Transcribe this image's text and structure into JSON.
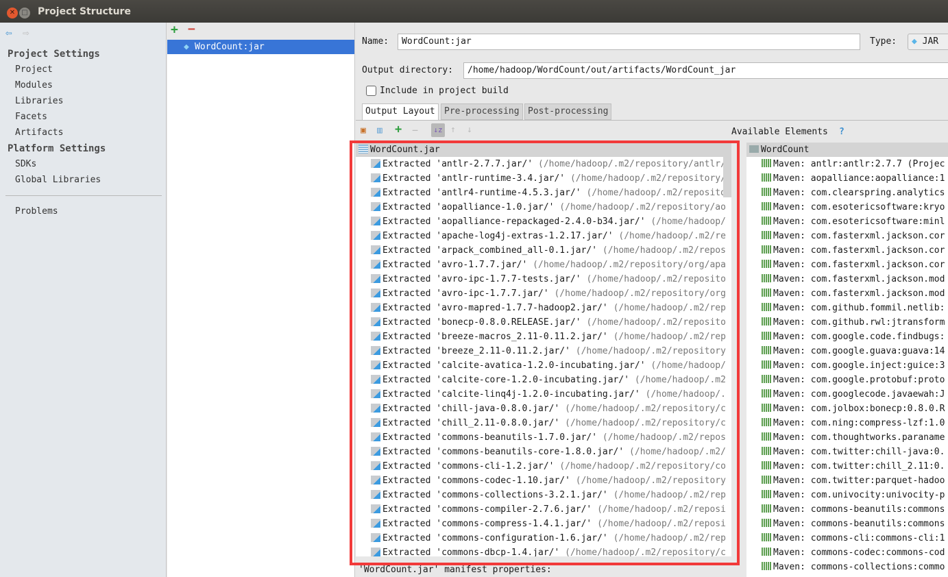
{
  "window": {
    "title": "Project Structure"
  },
  "sidebar": {
    "project_settings": "Project Settings",
    "project_items": [
      "Project",
      "Modules",
      "Libraries",
      "Facets",
      "Artifacts"
    ],
    "platform_settings": "Platform Settings",
    "platform_items": [
      "SDKs",
      "Global Libraries"
    ],
    "problems": "Problems"
  },
  "artifacts": {
    "selected": "WordCount:jar"
  },
  "form": {
    "name_label": "Name:",
    "name_value": "WordCount:jar",
    "type_label": "Type:",
    "type_value": "JAR",
    "output_label": "Output directory:",
    "output_value": "/home/hadoop/WordCount/out/artifacts/WordCount_jar",
    "include_label": "Include in project build",
    "include_checked": false
  },
  "tabs": [
    "Output Layout",
    "Pre-processing",
    "Post-processing"
  ],
  "available_label": "Available Elements",
  "help": "?",
  "tree": {
    "root": "WordCount.jar",
    "prefix": "Extracted",
    "items": [
      {
        "name": "'antlr-2.7.7.jar/'",
        "path": "(/home/hadoop/.m2/repository/antlr/"
      },
      {
        "name": "'antlr-runtime-3.4.jar/'",
        "path": "(/home/hadoop/.m2/repository/"
      },
      {
        "name": "'antlr4-runtime-4.5.3.jar/'",
        "path": "(/home/hadoop/.m2/reposito"
      },
      {
        "name": "'aopalliance-1.0.jar/'",
        "path": "(/home/hadoop/.m2/repository/ao"
      },
      {
        "name": "'aopalliance-repackaged-2.4.0-b34.jar/'",
        "path": "(/home/hadoop/"
      },
      {
        "name": "'apache-log4j-extras-1.2.17.jar/'",
        "path": "(/home/hadoop/.m2/re"
      },
      {
        "name": "'arpack_combined_all-0.1.jar/'",
        "path": "(/home/hadoop/.m2/repos"
      },
      {
        "name": "'avro-1.7.7.jar/'",
        "path": "(/home/hadoop/.m2/repository/org/apa"
      },
      {
        "name": "'avro-ipc-1.7.7-tests.jar/'",
        "path": "(/home/hadoop/.m2/reposito"
      },
      {
        "name": "'avro-ipc-1.7.7.jar/'",
        "path": "(/home/hadoop/.m2/repository/org"
      },
      {
        "name": "'avro-mapred-1.7.7-hadoop2.jar/'",
        "path": "(/home/hadoop/.m2/rep"
      },
      {
        "name": "'bonecp-0.8.0.RELEASE.jar/'",
        "path": "(/home/hadoop/.m2/reposito"
      },
      {
        "name": "'breeze-macros_2.11-0.11.2.jar/'",
        "path": "(/home/hadoop/.m2/rep"
      },
      {
        "name": "'breeze_2.11-0.11.2.jar/'",
        "path": "(/home/hadoop/.m2/repository"
      },
      {
        "name": "'calcite-avatica-1.2.0-incubating.jar/'",
        "path": "(/home/hadoop/"
      },
      {
        "name": "'calcite-core-1.2.0-incubating.jar/'",
        "path": "(/home/hadoop/.m2"
      },
      {
        "name": "'calcite-linq4j-1.2.0-incubating.jar/'",
        "path": "(/home/hadoop/."
      },
      {
        "name": "'chill-java-0.8.0.jar/'",
        "path": "(/home/hadoop/.m2/repository/c"
      },
      {
        "name": "'chill_2.11-0.8.0.jar/'",
        "path": "(/home/hadoop/.m2/repository/c"
      },
      {
        "name": "'commons-beanutils-1.7.0.jar/'",
        "path": "(/home/hadoop/.m2/repos"
      },
      {
        "name": "'commons-beanutils-core-1.8.0.jar/'",
        "path": "(/home/hadoop/.m2/"
      },
      {
        "name": "'commons-cli-1.2.jar/'",
        "path": "(/home/hadoop/.m2/repository/co"
      },
      {
        "name": "'commons-codec-1.10.jar/'",
        "path": "(/home/hadoop/.m2/repository"
      },
      {
        "name": "'commons-collections-3.2.1.jar/'",
        "path": "(/home/hadoop/.m2/rep"
      },
      {
        "name": "'commons-compiler-2.7.6.jar/'",
        "path": "(/home/hadoop/.m2/reposi"
      },
      {
        "name": "'commons-compress-1.4.1.jar/'",
        "path": "(/home/hadoop/.m2/reposi"
      },
      {
        "name": "'commons-configuration-1.6.jar/'",
        "path": "(/home/hadoop/.m2/rep"
      },
      {
        "name": "'commons-dbcp-1.4.jar/'",
        "path": "(/home/hadoop/.m2/repository/c"
      }
    ]
  },
  "manifest_label": "'WordCount.jar' manifest properties:",
  "available": {
    "root": "WordCount",
    "prefix": "Maven:",
    "items": [
      "antlr:antlr:2.7.7 (Projec",
      "aopalliance:aopalliance:1",
      "com.clearspring.analytics",
      "com.esotericsoftware:kryo",
      "com.esotericsoftware:minl",
      "com.fasterxml.jackson.cor",
      "com.fasterxml.jackson.cor",
      "com.fasterxml.jackson.cor",
      "com.fasterxml.jackson.mod",
      "com.fasterxml.jackson.mod",
      "com.github.fommil.netlib:",
      "com.github.rwl:jtransform",
      "com.google.code.findbugs:",
      "com.google.guava:guava:14",
      "com.google.inject:guice:3",
      "com.google.protobuf:proto",
      "com.googlecode.javaewah:J",
      "com.jolbox:bonecp:0.8.0.R",
      "com.ning:compress-lzf:1.0",
      "com.thoughtworks.paraname",
      "com.twitter:chill-java:0.",
      "com.twitter:chill_2.11:0.",
      "com.twitter:parquet-hadoo",
      "com.univocity:univocity-p",
      "commons-beanutils:commons",
      "commons-beanutils:commons",
      "commons-cli:commons-cli:1",
      "commons-codec:commons-cod",
      "commons-collections:commo"
    ]
  },
  "colors": {
    "selection": "#3875d7",
    "highlight_box": "#f23a3a",
    "add": "#2e9e3e",
    "remove": "#d0453a"
  }
}
